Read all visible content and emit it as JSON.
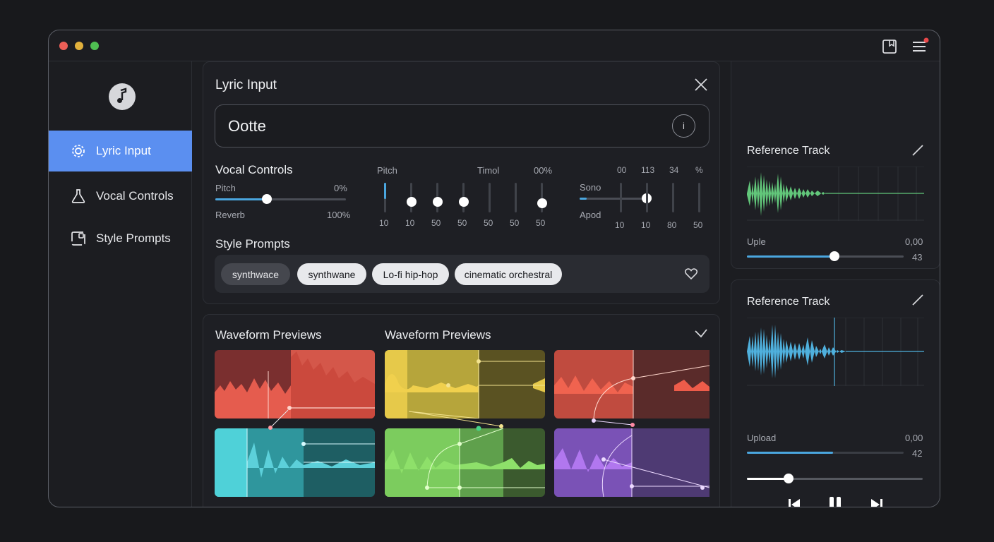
{
  "colors": {
    "accent": "#5b8ff0",
    "slider": "#4aa6df",
    "green_wave": "#62c67a",
    "blue_wave": "#4fb0dd"
  },
  "sidebar": {
    "logo_icon": "music-note-icon",
    "items": [
      {
        "label": "Lyric Input",
        "icon": "gear-icon",
        "active": true
      },
      {
        "label": "Vocal Controls",
        "icon": "flask-icon",
        "active": false
      },
      {
        "label": "Style Prompts",
        "icon": "layout-icon",
        "active": false
      }
    ]
  },
  "lyric": {
    "title": "Lyric Input",
    "value": "Ootte",
    "info_glyph": "i"
  },
  "vocal": {
    "title": "Vocal Controls",
    "pitch_label": "Pitch",
    "pitch_value": "0%",
    "pitch_level": 0.39,
    "reverb_label": "Reverb",
    "reverb_value": "100%",
    "mixer_pitch_label": "Pitch",
    "mixer_timbre_label": "Timol",
    "mixer_value": "00%",
    "mixer_levels": [
      0.7,
      0.35,
      0.35,
      0.35,
      0.0,
      0.0,
      0.3
    ],
    "mixer_numbers": [
      "10",
      "10",
      "50",
      "50",
      "50",
      "50",
      "50"
    ],
    "sono_label": "Sono",
    "apod_label": "Apod",
    "sono_level": 0.5,
    "sono_header": [
      "00",
      "113",
      "34",
      "%"
    ],
    "sono_levels": [
      0.0,
      0.55,
      0.0,
      0.0
    ],
    "sono_numbers": [
      "10",
      "10",
      "80",
      "50"
    ]
  },
  "style": {
    "title": "Style Prompts",
    "tags": [
      "synthwace",
      "synthwane",
      "Lo-fi hip-hop",
      "cinematic orchestral"
    ]
  },
  "waveforms": {
    "title_left": "Waveform Previews",
    "title_right": "Waveform Previews"
  },
  "ref1": {
    "title": "Reference Track",
    "slider_label": "Uple",
    "slider_value": "0,00",
    "slider_sub": "43",
    "slider_level": 0.5
  },
  "ref2": {
    "title": "Reference Track",
    "slider_label": "Upload",
    "slider_value": "0,00",
    "slider_sub": "42",
    "slider_level": 0.55,
    "playback_level": 0.24
  }
}
